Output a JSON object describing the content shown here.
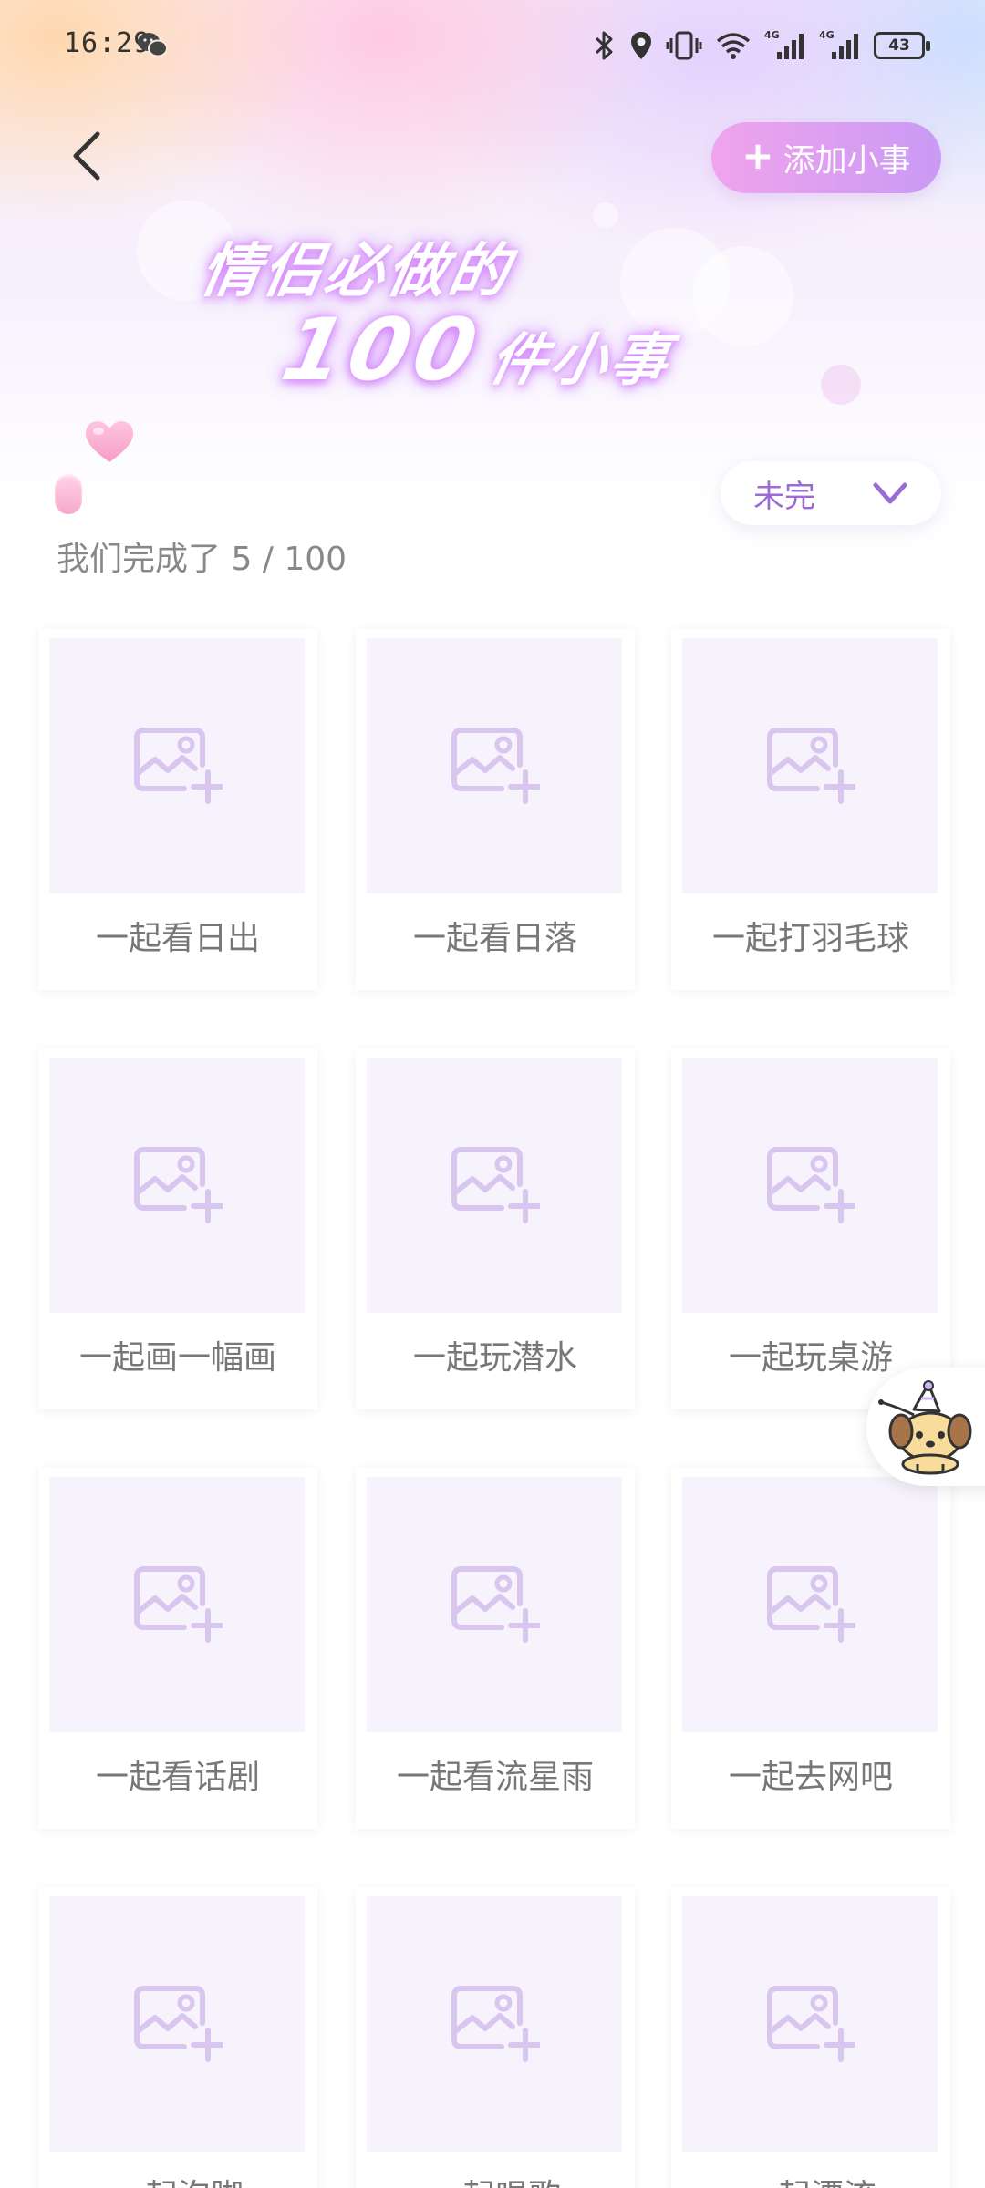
{
  "status_bar": {
    "time": "16:29",
    "battery": "43",
    "icons": [
      "wechat-icon",
      "bluetooth-icon",
      "location-icon",
      "vibrate-icon",
      "wifi-icon",
      "signal-4g-icon",
      "signal-4g-icon"
    ]
  },
  "header": {
    "back_icon": "chevron-left-icon",
    "add_button_label": "添加小事",
    "title_line1": "情侣必做的",
    "title_number": "100",
    "title_tail": "件小事"
  },
  "filter": {
    "selected": "未完",
    "icon": "chevron-down-icon"
  },
  "progress": {
    "text": "我们完成了 5 / 100",
    "done": 5,
    "total": 100
  },
  "items": [
    {
      "label": "一起看日出"
    },
    {
      "label": "一起看日落"
    },
    {
      "label": "一起打羽毛球"
    },
    {
      "label": "一起画一幅画"
    },
    {
      "label": "一起玩潜水"
    },
    {
      "label": "一起玩桌游"
    },
    {
      "label": "一起看话剧"
    },
    {
      "label": "一起看流星雨"
    },
    {
      "label": "一起去网吧"
    },
    {
      "label": "一起泡脚"
    },
    {
      "label": "一起唱歌"
    },
    {
      "label": "一起漂流"
    }
  ],
  "image_placeholder_icon": "add-image-icon",
  "colors": {
    "accent": "#9b6ad6",
    "button_gradient_start": "#f0a4ec",
    "button_gradient_end": "#c99af5",
    "placeholder_bg": "#f7f3fc",
    "placeholder_icon": "#d8c6ef"
  }
}
